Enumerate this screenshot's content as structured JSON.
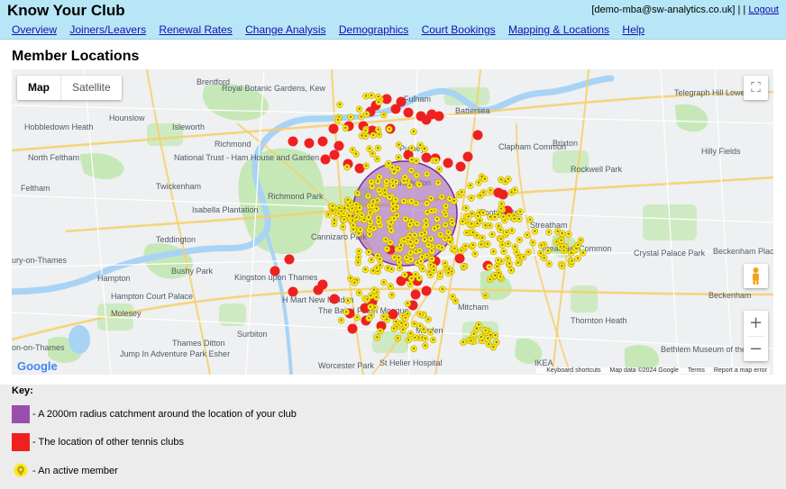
{
  "header": {
    "app_title": "Know Your Club",
    "user_email": "[demo-mba@sw-analytics.co.uk]",
    "separator": "| |",
    "logout_label": "Logout"
  },
  "nav": {
    "items": [
      {
        "label": "Overview"
      },
      {
        "label": "Joiners/Leavers"
      },
      {
        "label": "Renewal Rates"
      },
      {
        "label": "Change Analysis"
      },
      {
        "label": "Demographics"
      },
      {
        "label": "Court Bookings"
      },
      {
        "label": "Mapping & Locations"
      },
      {
        "label": "Help"
      }
    ]
  },
  "page": {
    "title": "Member Locations"
  },
  "map": {
    "type_controls": {
      "map_label": "Map",
      "satellite_label": "Satellite",
      "selected": "Map"
    },
    "zoom_in_label": "+",
    "zoom_out_label": "−",
    "logo_text": "Google",
    "attribution": {
      "keyboard_shortcuts": "Keyboard shortcuts",
      "map_data": "Map data ©2024 Google",
      "terms": "Terms",
      "report": "Report a map error"
    },
    "place_labels": [
      "Brentford",
      "Royal Botanic Gardens, Kew",
      "Hobbledown Heath",
      "Hounslow",
      "Isleworth",
      "Richmond",
      "Putney",
      "Fulham",
      "Battersea",
      "Clapham Common",
      "Brixton",
      "Telegraph Hill Lower Park",
      "North Feltham",
      "National Trust - Ham House and Garden",
      "Feltham",
      "Twickenham",
      "Richmond Park",
      "Isabella Plantation",
      "Wimbledon",
      "Cannizaro Park",
      "Tooting Bec",
      "Streatham",
      "Rockwell Park",
      "Hilly Fields",
      "Teddington",
      "Bushy Park",
      "Kingston upon Thames",
      "Streatham Common",
      "Crystal Palace Park",
      "Beckenham Place Park",
      "Hampton",
      "Hampton Court Palace",
      "H Mart New Malden",
      "Molesey",
      "The Baitul Futuh Mosque",
      "Mitcham",
      "Beckenham",
      "Surbiton",
      "Morden",
      "Thames Ditton",
      "Thornton Heath",
      "Jump In Adventure Park Esher",
      "Worcester Park",
      "St Helier Hospital",
      "IKEA",
      "Bethlem Museum of the Mind",
      "ury-on-Thames",
      "on-on-Thames"
    ],
    "colors": {
      "catchment": "#9a4fb0",
      "tennis_club": "#ef2020",
      "member": "#f6ec1a",
      "park": "#c6e8b7",
      "water": "#a8d3f5"
    }
  },
  "key": {
    "title": "Key:",
    "items": [
      {
        "icon": "catchment-swatch",
        "label": "- A 2000m radius catchment around the location of your club"
      },
      {
        "icon": "tennis-club-swatch",
        "label": "- The location of other tennis clubs"
      },
      {
        "icon": "member-pin-icon",
        "label": "- An active member"
      }
    ]
  }
}
